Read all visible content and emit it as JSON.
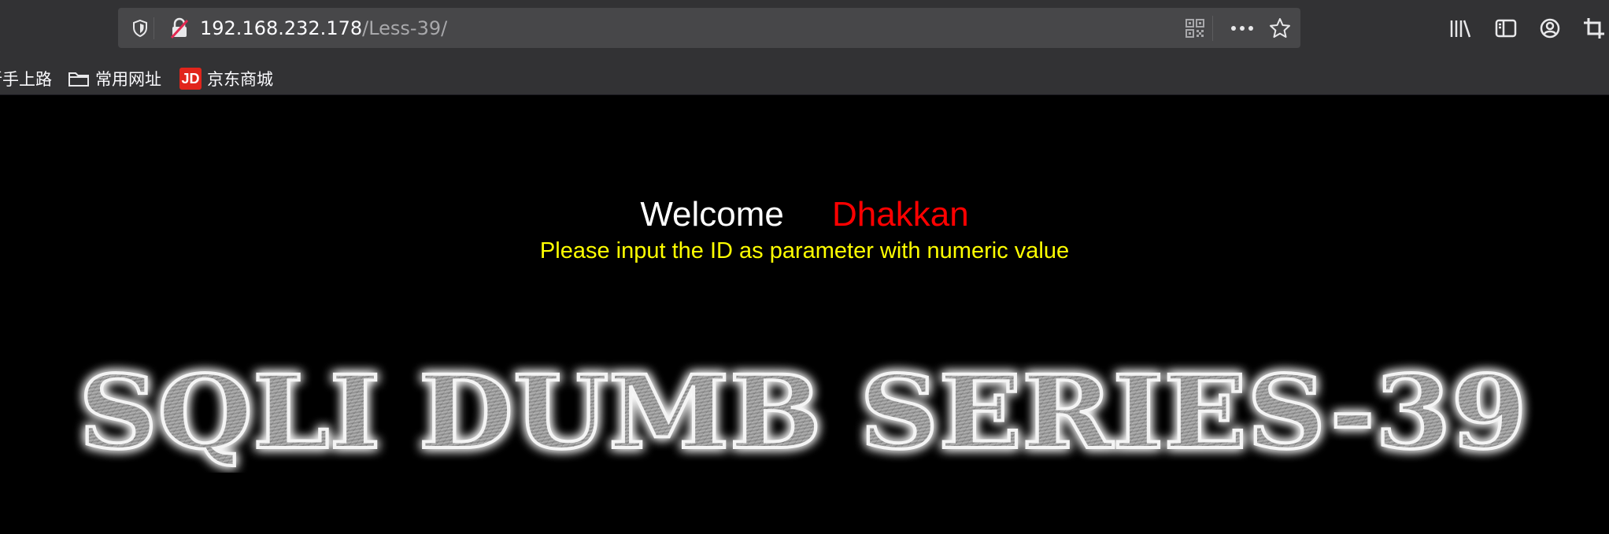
{
  "browser": {
    "url_host": "192.168.232.178",
    "url_path": "/Less-39/",
    "icons": {
      "tracking_protection": "shield-icon",
      "insecure_connection": "lock-insecure-icon",
      "qr_code": "qr-code-icon",
      "page_actions": "more-icon",
      "bookmark_star": "star-icon",
      "library": "library-icon",
      "sidebar": "sidebar-icon",
      "account": "account-icon",
      "screenshot": "crop-icon"
    }
  },
  "bookmarks": {
    "items": [
      {
        "label": "新手上路",
        "icon": "none"
      },
      {
        "label": "常用网址",
        "icon": "folder-icon"
      },
      {
        "label": "京东商城",
        "icon": "jd-logo-icon",
        "icon_text": "JD"
      }
    ]
  },
  "page": {
    "welcome": "Welcome",
    "name": "Dhakkan",
    "instructions": "Please input the ID as parameter with numeric value",
    "banner_text": "SQLI DUMB SERIES-39",
    "colors": {
      "background": "#000000",
      "welcome": "#ffffff",
      "name": "#ff0000",
      "instructions": "#ffff00"
    }
  }
}
